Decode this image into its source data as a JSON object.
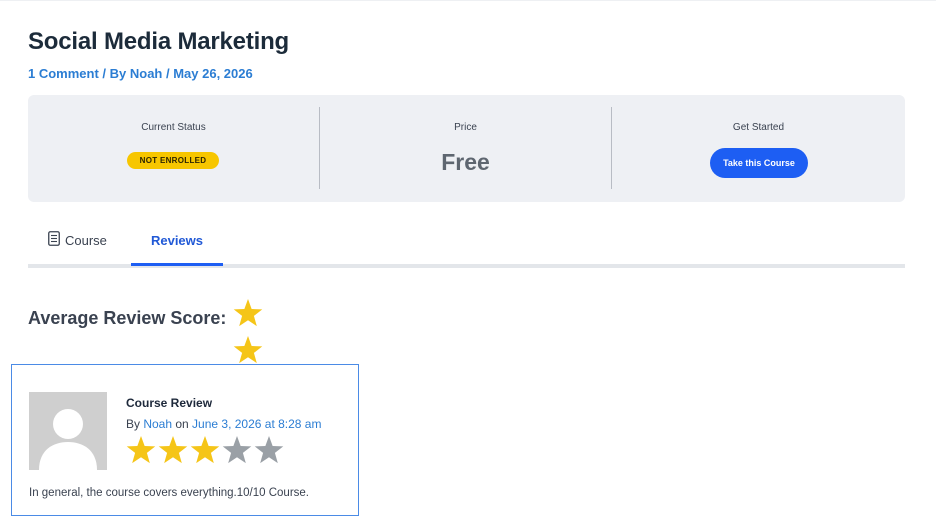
{
  "post": {
    "title": "Social Media Marketing",
    "comment_link": "1 Comment",
    "separator1": " / By ",
    "author": "Noah",
    "separator2": " / ",
    "date": "May 26, 2026"
  },
  "status_box": {
    "current_status_label": "Current Status",
    "current_status_value": "NOT ENROLLED",
    "price_label": "Price",
    "price_value": "Free",
    "get_started_label": "Get Started",
    "cta_label": "Take this Course"
  },
  "tabs": [
    {
      "label": "Course",
      "icon": "document-icon",
      "active": false
    },
    {
      "label": "Reviews",
      "active": true
    }
  ],
  "average": {
    "label": "Average Review Score:",
    "rating": 3,
    "max": 5
  },
  "review": {
    "title": "Course Review",
    "by_prefix": "By ",
    "author": "Noah",
    "on_word": " on ",
    "date": "June 3, 2026 at 8:28 am",
    "rating": 3,
    "max": 5,
    "text": "In general, the course covers everything.10/10 Course."
  },
  "colors": {
    "star_filled": "#f5c518",
    "star_empty": "#9aa0a6",
    "accent": "#1d5ef3",
    "badge": "#f7c600"
  }
}
